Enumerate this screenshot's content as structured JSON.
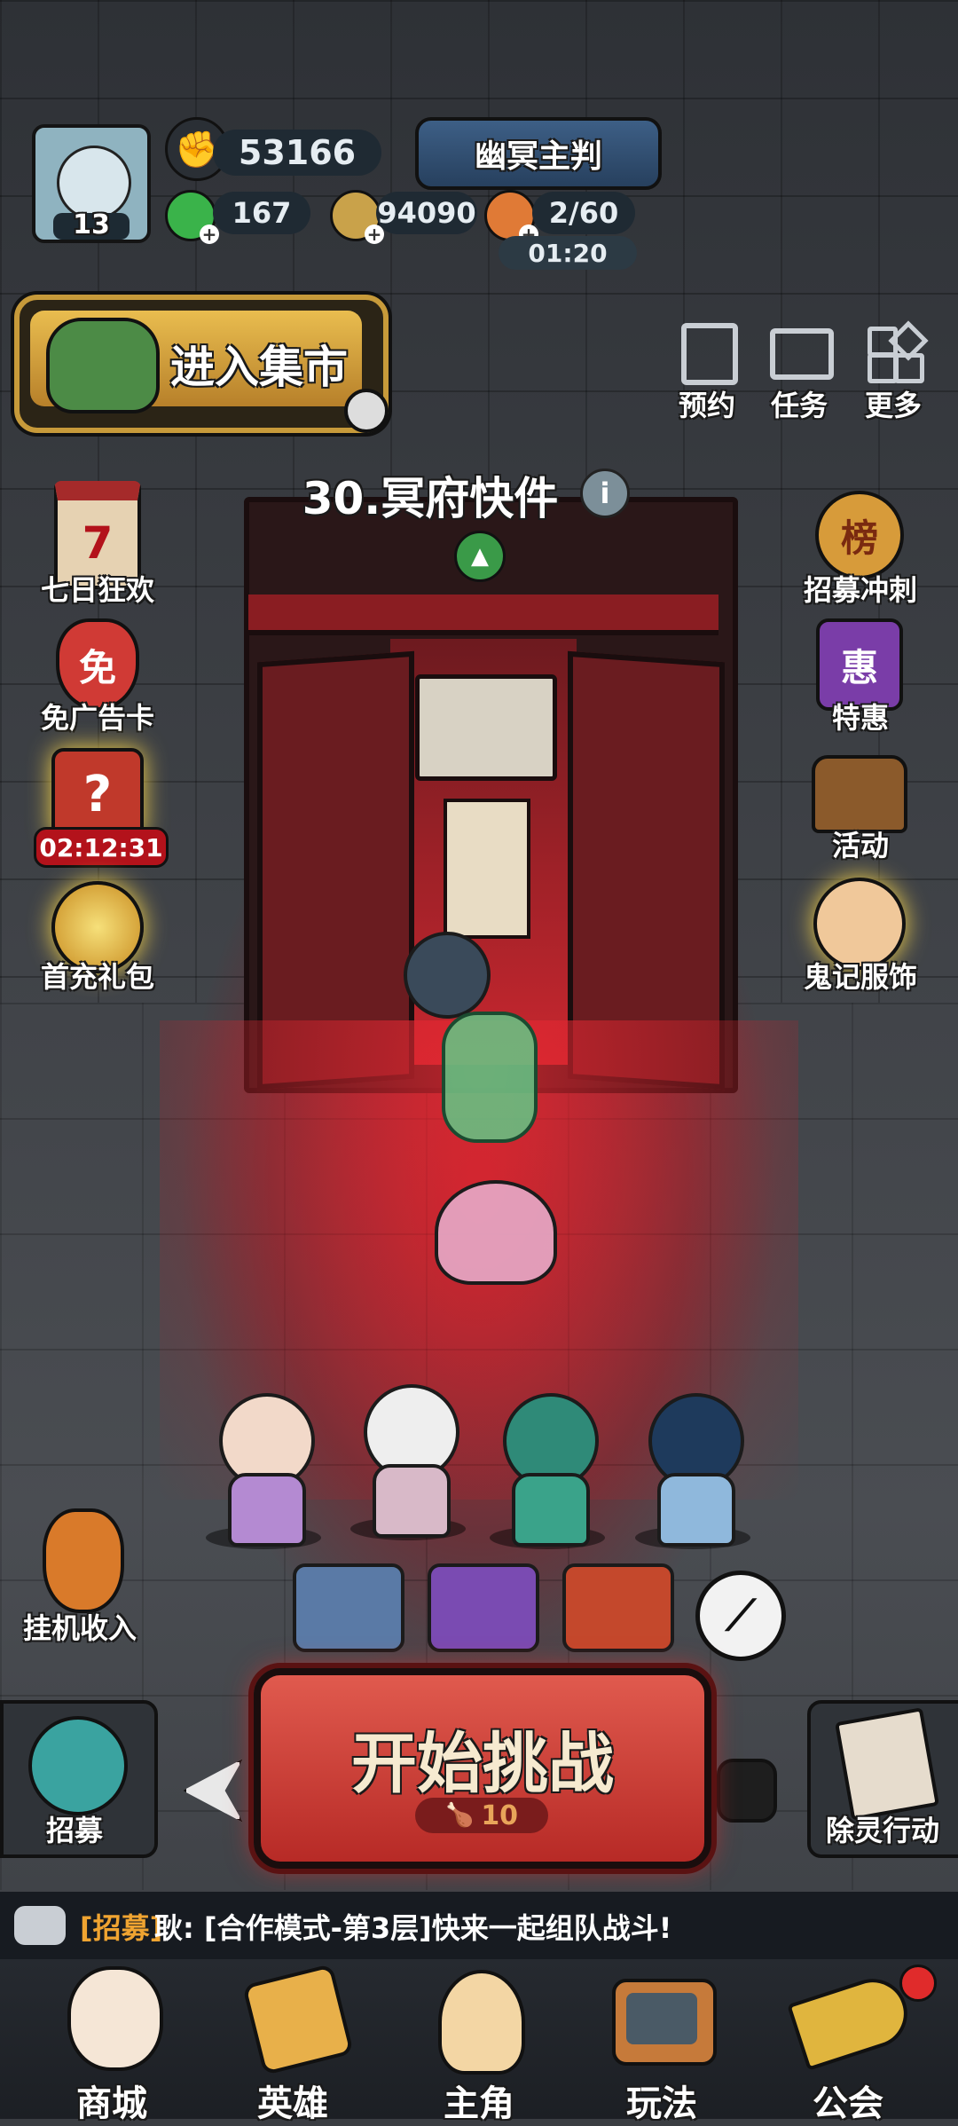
{
  "player": {
    "level": "13",
    "power": "53166",
    "rank_title": "幽冥主判",
    "jade": "167",
    "coins": "94090",
    "stamina": "2/60",
    "stamina_timer": "01:20"
  },
  "market": {
    "label": "进入集市"
  },
  "top_right_menu": [
    {
      "label": "预约",
      "icon": "clipboard-icon"
    },
    {
      "label": "任务",
      "icon": "task-board-icon"
    },
    {
      "label": "更多",
      "icon": "grid-more-icon"
    }
  ],
  "stage": {
    "title": "30.冥府快件",
    "info_icon": "info-icon"
  },
  "left_events": [
    {
      "label": "七日狂欢",
      "icon": "seven-day-calendar-icon",
      "glyph": "7"
    },
    {
      "label": "免广告卡",
      "icon": "ad-free-card-icon",
      "glyph": "免"
    },
    {
      "label": "02:12:31",
      "icon": "mystery-gift-icon",
      "glyph": "?"
    },
    {
      "label": "首充礼包",
      "icon": "first-charge-gift-icon"
    }
  ],
  "right_events": [
    {
      "label": "招募冲刺",
      "icon": "recruit-rank-icon",
      "glyph": "榜"
    },
    {
      "label": "特惠",
      "icon": "special-offer-icon",
      "glyph": "惠"
    },
    {
      "label": "活动",
      "icon": "event-chest-icon"
    },
    {
      "label": "鬼记服饰",
      "icon": "costume-shop-icon"
    }
  ],
  "idle_income": {
    "label": "挂机收入"
  },
  "recruit": {
    "label": "招募"
  },
  "exorcism": {
    "label": "除灵行动"
  },
  "start_button": {
    "label": "开始挑战",
    "cost": "10"
  },
  "chat": {
    "tag": "[招募]",
    "message": "耿: [合作模式-第3层]快来一起组队战斗!"
  },
  "bottom_nav": [
    {
      "label": "商城",
      "icon": "lucky-cat-icon"
    },
    {
      "label": "英雄",
      "icon": "hero-scroll-icon"
    },
    {
      "label": "主角",
      "icon": "protagonist-icon"
    },
    {
      "label": "玩法",
      "icon": "tv-icon"
    },
    {
      "label": "公会",
      "icon": "horn-icon"
    }
  ],
  "colors": {
    "red_glow": "#d81e28",
    "timer_red": "#b3121b",
    "gold": "#e8c34a",
    "chat_tag": "#f0a431",
    "pill_bg": "#1f2a33"
  }
}
